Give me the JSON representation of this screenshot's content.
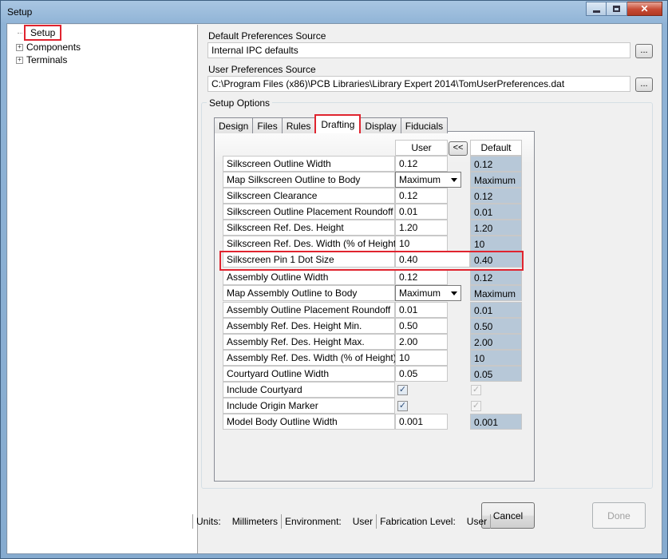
{
  "window": {
    "title": "Setup"
  },
  "tree": {
    "items": [
      {
        "label": "Setup",
        "expandable": false
      },
      {
        "label": "Components",
        "expandable": true
      },
      {
        "label": "Terminals",
        "expandable": true
      }
    ]
  },
  "default_prefs": {
    "label": "Default Preferences Source",
    "value": "Internal IPC defaults",
    "button": "..."
  },
  "user_prefs": {
    "label": "User Preferences Source",
    "value": "C:\\Program Files (x86)\\PCB Libraries\\Library Expert 2014\\TomUserPreferences.dat",
    "button": "..."
  },
  "setup_options": {
    "title": "Setup Options",
    "tabs": [
      "Design",
      "Files",
      "Rules",
      "Drafting",
      "Display",
      "Fiducials"
    ],
    "active_tab": "Drafting"
  },
  "grid": {
    "user_header": "User",
    "copy_button": "<<",
    "default_header": "Default",
    "rows": [
      {
        "label": "Silkscreen Outline Width",
        "user": "0.12",
        "default": "0.12"
      },
      {
        "label": "Map Silkscreen Outline to Body",
        "user": "Maximum",
        "default": "Maximum"
      },
      {
        "label": "Silkscreen Clearance",
        "user": "0.12",
        "default": "0.12"
      },
      {
        "label": "Silkscreen Outline Placement Roundoff",
        "user": "0.01",
        "default": "0.01"
      },
      {
        "label": "Silkscreen Ref. Des. Height",
        "user": "1.20",
        "default": "1.20"
      },
      {
        "label": "Silkscreen Ref. Des. Width (% of Height)",
        "user": "10",
        "default": "10"
      },
      {
        "label": "Silkscreen Pin 1 Dot Size",
        "user": "0.40",
        "default": "0.40"
      },
      {
        "label": "Assembly Outline Width",
        "user": "0.12",
        "default": "0.12"
      },
      {
        "label": "Map Assembly Outline to Body",
        "user": "Maximum",
        "default": "Maximum"
      },
      {
        "label": "Assembly Outline Placement Roundoff",
        "user": "0.01",
        "default": "0.01"
      },
      {
        "label": "Assembly Ref. Des.  Height Min.",
        "user": "0.50",
        "default": "0.50"
      },
      {
        "label": "Assembly Ref. Des. Height Max.",
        "user": "2.00",
        "default": "2.00"
      },
      {
        "label": "Assembly Ref. Des. Width (% of Height)",
        "user": "10",
        "default": "10"
      },
      {
        "label": "Courtyard Outline Width",
        "user": "0.05",
        "default": "0.05"
      },
      {
        "label": "Include Courtyard",
        "user_checked": true,
        "default_checked": true
      },
      {
        "label": "Include Origin Marker",
        "user_checked": true,
        "default_checked": true
      },
      {
        "label": "Model Body Outline Width",
        "user": "0.001",
        "default": "0.001"
      }
    ]
  },
  "buttons": {
    "cancel": "Cancel",
    "done": "Done"
  },
  "status": {
    "units_label": "Units:",
    "units_value": "Millimeters",
    "env_label": "Environment:",
    "env_value": "User",
    "fab_label": "Fabrication Level:",
    "fab_value": "User"
  },
  "colors": {
    "highlight": "#e0242f",
    "default_cell_bg": "#b7c8d8"
  }
}
